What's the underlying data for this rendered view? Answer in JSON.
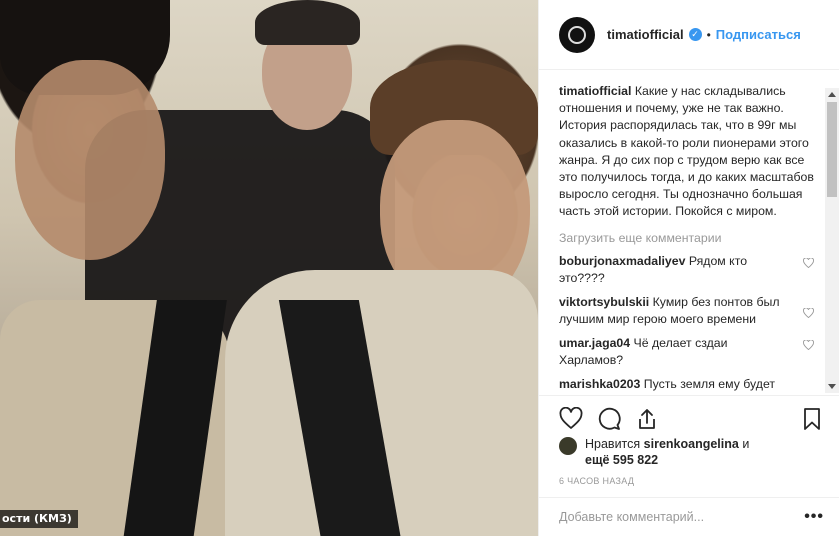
{
  "post": {
    "watermark": "ости (КМЗ)"
  },
  "header": {
    "username": "timatiofficial",
    "verified_mark": "✓",
    "dot": "•",
    "follow_label": "Подписаться"
  },
  "caption": {
    "username": "timatiofficial",
    "text": "Какие у нас складывались отношения и почему, уже не так важно. История распорядилась так, что в 99г мы оказались в какой-то роли пионерами этого жанра. Я до сих пор с трудом верю как все это получилось тогда, и до каких масштабов выросло сегодня. Ты однозначно большая часть этой истории. Покойся с миром."
  },
  "load_more_label": "Загрузить еще комментарии",
  "comments": [
    {
      "username": "boburjonaxmadaliyev",
      "text": "Рядом кто это????"
    },
    {
      "username": "viktortsybulskii",
      "text": "Кумир без понтов был лучшим мир герою моего времени"
    },
    {
      "username": "umar.jaga04",
      "text": "Чё делает сздаи Харламов?"
    },
    {
      "username": "marishka0203",
      "text": "Пусть земля ему будет"
    }
  ],
  "likes": {
    "prefix": "Нравится",
    "user": "sirenkoangelina",
    "middle": "и",
    "count": "ещё 595 822"
  },
  "time_ago": "6 ЧАСОВ НАЗАД",
  "add_comment": {
    "placeholder": "Добавьте комментарий...",
    "more": "•••"
  },
  "icons": {
    "like": "heart-icon",
    "comment": "comment-icon",
    "share": "share-icon",
    "save": "bookmark-icon"
  },
  "colors": {
    "accent": "#3897f0",
    "text": "#262626",
    "muted": "#999999"
  }
}
